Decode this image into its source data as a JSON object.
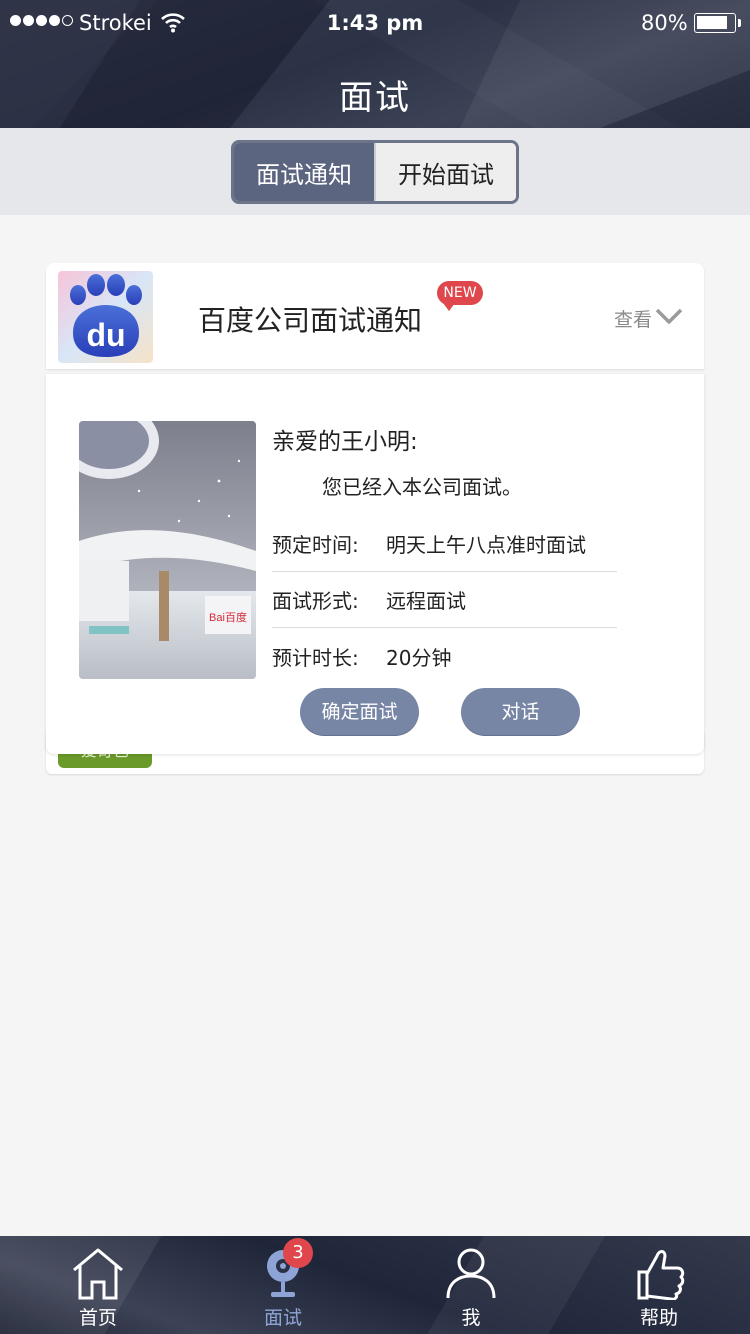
{
  "status_bar": {
    "carrier": "Strokei",
    "time": "1:43 pm",
    "battery_percent": "80%",
    "battery_level": 0.8,
    "signal_bars": 4
  },
  "header": {
    "title": "面试"
  },
  "segmented": {
    "tabs": [
      {
        "label": "面试通知",
        "selected": true
      },
      {
        "label": "开始面试",
        "selected": false
      }
    ]
  },
  "card": {
    "logo_icon": "baidu-paw-logo",
    "logo_text": "du",
    "title": "百度公司面试通知",
    "badge": "NEW",
    "view_label": "查看",
    "photo_sign": "Bai百度",
    "greeting": "亲爱的王小明:",
    "intro": "您已经入本公司面试。",
    "rows": [
      {
        "label": "预定时间:",
        "value": "明天上午八点准时面试"
      },
      {
        "label": "面试形式:",
        "value": "远程面试"
      },
      {
        "label": "预计时长:",
        "value": "20分钟"
      }
    ],
    "buttons": {
      "confirm": "确定面试",
      "chat": "对话"
    }
  },
  "next_card": {
    "tag": "爱奇艺"
  },
  "tabbar": {
    "items": [
      {
        "label": "首页",
        "icon": "home-icon"
      },
      {
        "label": "面试",
        "icon": "webcam-icon",
        "badge": "3",
        "active": true
      },
      {
        "label": "我",
        "icon": "person-icon"
      },
      {
        "label": "帮助",
        "icon": "thumbs-up-icon"
      }
    ]
  },
  "colors": {
    "accent": "#5c6580",
    "button": "#7886a6",
    "badge": "#e0474c",
    "active_tab": "#8ea4d6",
    "tag_green": "#6a9a2a"
  }
}
